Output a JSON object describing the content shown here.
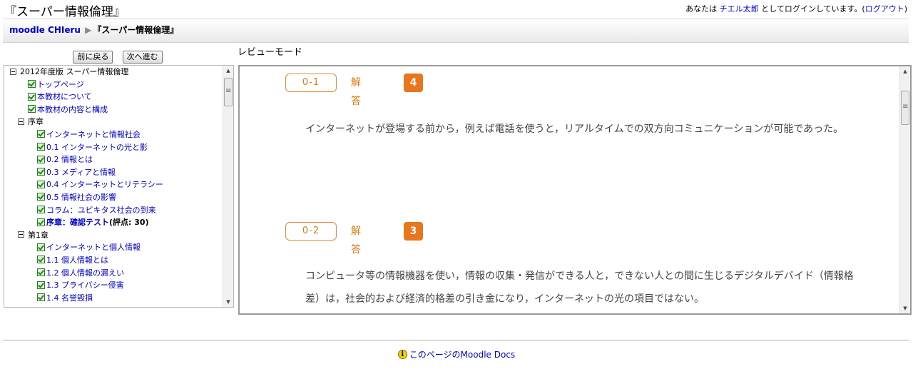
{
  "header": {
    "title": "『スーパー情報倫理』",
    "login_prefix": "あなたは",
    "user_name": "チエル太郎",
    "login_suffix": "としてログインしています。(",
    "logout": "ログアウト",
    "login_close": ")"
  },
  "breadcrumb": {
    "home": "moodle CHIeru",
    "separator": "▶",
    "current": "『スーパー情報倫理』"
  },
  "toc_nav": {
    "prev": "前に戻る",
    "next": "次へ進む"
  },
  "toc": {
    "root": "2012年度版 スーパー情報倫理",
    "items": [
      {
        "label": "トップページ",
        "level": "lvl1",
        "type": "link"
      },
      {
        "label": "本教材について",
        "level": "lvl1",
        "type": "link"
      },
      {
        "label": "本教材の内容と構成",
        "level": "lvl1",
        "type": "link"
      },
      {
        "label": "序章",
        "level": "lvl1e",
        "type": "folder"
      },
      {
        "label": "インターネットと情報社会",
        "level": "lvl2",
        "type": "link"
      },
      {
        "label": "0.1 インターネットの光と影",
        "level": "lvl2",
        "type": "link"
      },
      {
        "label": "0.2 情報とは",
        "level": "lvl2",
        "type": "link"
      },
      {
        "label": "0.3 メディアと情報",
        "level": "lvl2",
        "type": "link"
      },
      {
        "label": "0.4 インターネットとリテラシー",
        "level": "lvl2",
        "type": "link"
      },
      {
        "label": "0.5 情報社会の影響",
        "level": "lvl2",
        "type": "link"
      },
      {
        "label": "コラム：ユビキタス社会の到来",
        "level": "lvl2",
        "type": "link"
      },
      {
        "label": "序章：確認テスト",
        "suffix": "(評点: 30)",
        "level": "lvl2",
        "type": "bold"
      },
      {
        "label": "第1章",
        "level": "lvl1e",
        "type": "folder"
      },
      {
        "label": "インターネットと個人情報",
        "level": "lvl2",
        "type": "link"
      },
      {
        "label": "1.1 個人情報とは",
        "level": "lvl2",
        "type": "link"
      },
      {
        "label": "1.2 個人情報の漏えい",
        "level": "lvl2",
        "type": "link"
      },
      {
        "label": "1.3 プライバシー侵害",
        "level": "lvl2",
        "type": "link"
      },
      {
        "label": "1.4 名誉毀損",
        "level": "lvl2",
        "type": "link"
      }
    ]
  },
  "mode_label": "レビューモード",
  "answers": [
    {
      "qnum": "0-1",
      "label": "解答",
      "answer": "4",
      "text": "インターネットが登場する前から，例えば電話を使うと，リアルタイムでの双方向コミュニケーションが可能であった。"
    },
    {
      "qnum": "0-2",
      "label": "解答",
      "answer": "3",
      "text": "コンピュータ等の情報機器を使い，情報の収集・発信ができる人と，できない人との間に生じるデジタルデバイド（情報格差）は，社会的および経済的格差の引き金になり，インターネットの光の項目ではない。"
    }
  ],
  "footer": {
    "docs_link": "このページのMoodle Docs"
  },
  "colors": {
    "accent_orange": "#e8761e",
    "link_blue": "#0000cc"
  }
}
